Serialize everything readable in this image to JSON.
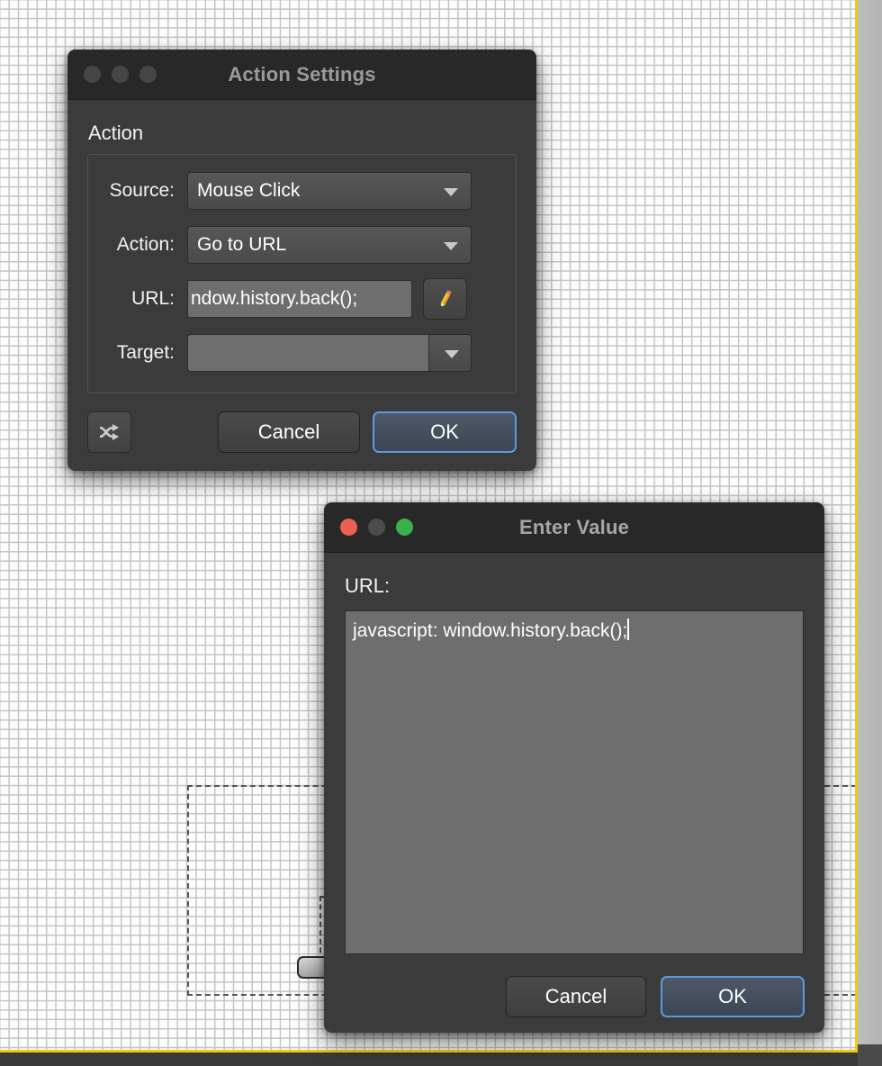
{
  "canvas": {
    "background_color": "#fdfdfd",
    "grid_color": "#c4c4c4",
    "guide_color": "#f2c915",
    "chrome_color": "#3a3a3a"
  },
  "action_settings": {
    "title": "Action Settings",
    "window_state": "inactive",
    "group_label": "Action",
    "rows": [
      {
        "label": "Source:",
        "value": "Mouse Click",
        "control": "combobox"
      },
      {
        "label": "Action:",
        "value": "Go to URL",
        "control": "combobox"
      },
      {
        "label": "URL:",
        "value": "ndow.history.back();",
        "control": "textfield"
      },
      {
        "label": "Target:",
        "value": "",
        "control": "editable-combobox"
      }
    ],
    "edit_icon": "pencil-icon",
    "shuffle_icon": "shuffle-icon",
    "cancel_label": "Cancel",
    "ok_label": "OK",
    "default_button": "OK",
    "focus_ring_color": "#5b9ae0"
  },
  "enter_value": {
    "title": "Enter Value",
    "window_state": "active",
    "field_label": "URL:",
    "value": "javascript: window.history.back();",
    "cancel_label": "Cancel",
    "ok_label": "OK",
    "default_button": "OK",
    "traffic_lights": {
      "close_color": "#ec5f53",
      "minimize_color": "#4c4c4c",
      "zoom_color": "#3ab14a"
    }
  }
}
